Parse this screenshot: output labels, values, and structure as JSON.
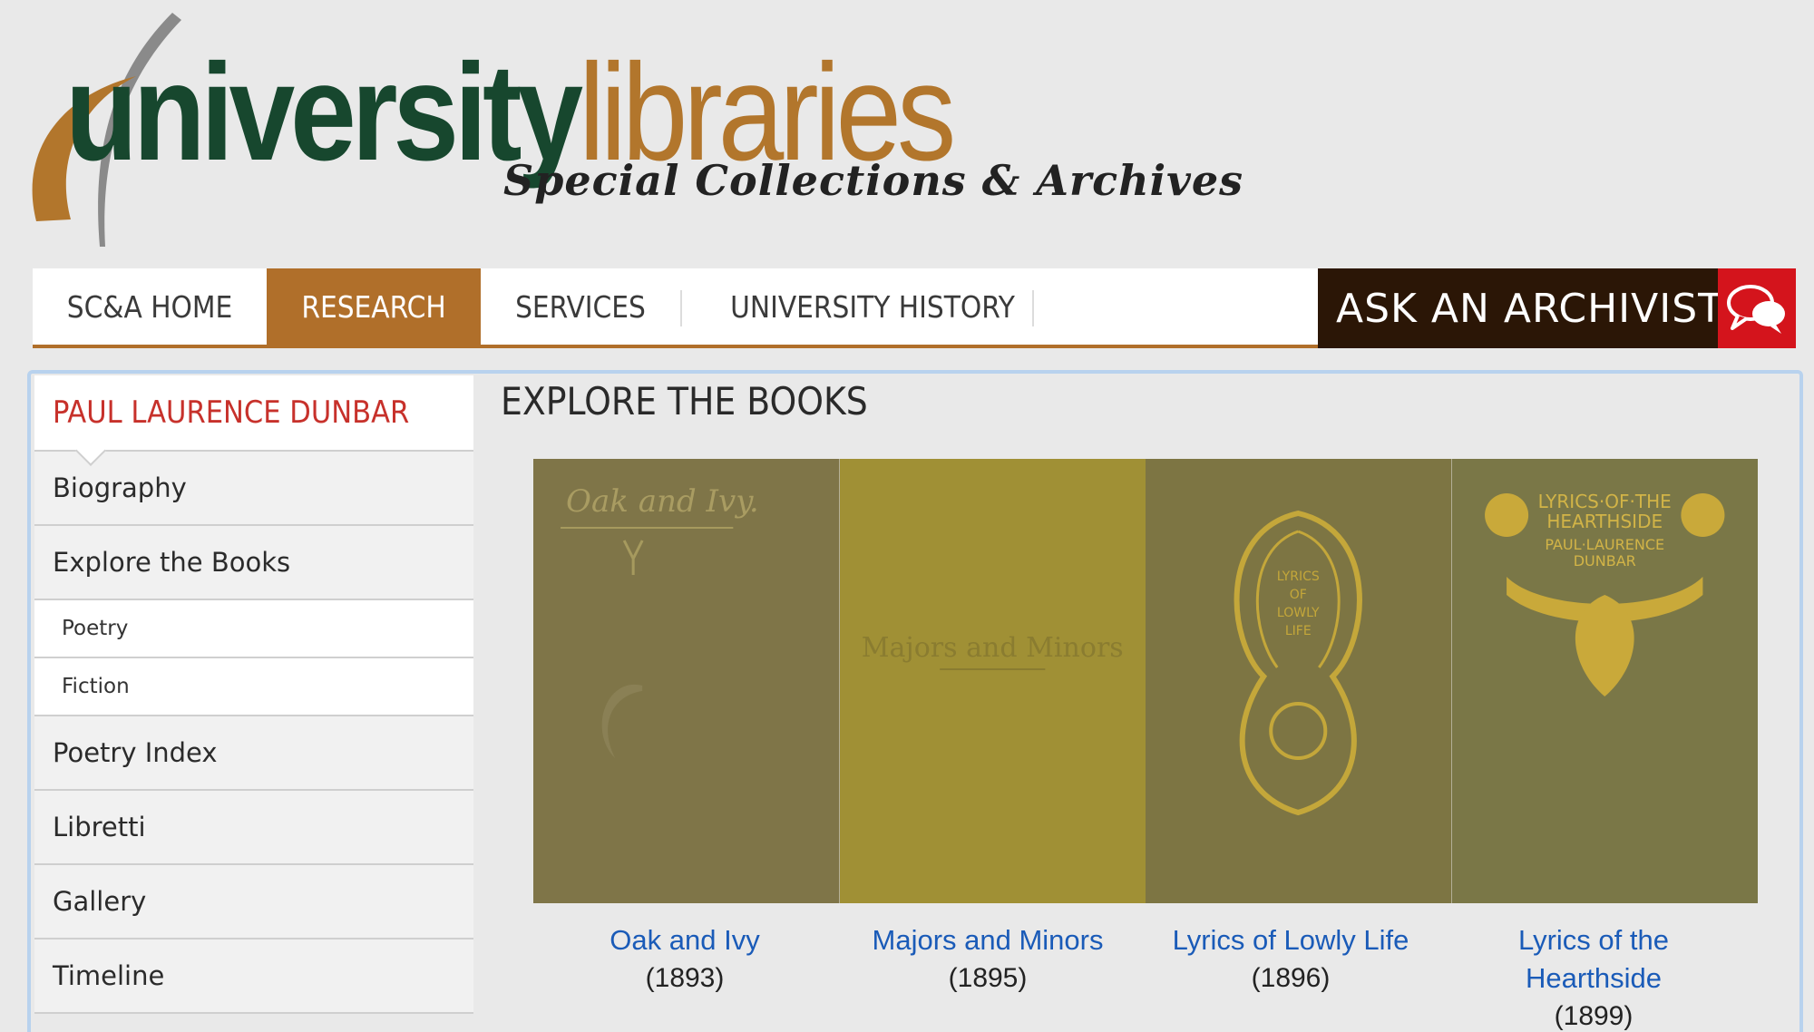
{
  "logo": {
    "word1": "university",
    "word2": "libraries",
    "tagline": "Special Collections & Archives",
    "colors": {
      "green": "#17472e",
      "gold": "#b2762c"
    }
  },
  "nav": {
    "items": [
      {
        "label": "SC&A HOME",
        "active": false
      },
      {
        "label": "RESEARCH",
        "active": true
      },
      {
        "label": "SERVICES",
        "active": false
      },
      {
        "label": "UNIVERSITY HISTORY",
        "active": false
      }
    ],
    "ask_label": "ASK AN ARCHIVIST",
    "ask_icon": "chat-bubbles-icon",
    "accent": "#b06f2a",
    "ask_bg": "#2b1606",
    "ask_icon_bg": "#d4141c"
  },
  "sidebar": {
    "title": "PAUL LAURENCE DUNBAR",
    "items": [
      {
        "label": "Biography"
      },
      {
        "label": "Explore the Books"
      },
      {
        "label": "Poetry"
      },
      {
        "label": "Fiction"
      },
      {
        "label": "Poetry Index"
      },
      {
        "label": "Libretti"
      },
      {
        "label": "Gallery"
      },
      {
        "label": "Timeline"
      }
    ]
  },
  "main": {
    "title": "EXPLORE THE BOOKS",
    "books": [
      {
        "title": "Oak and Ivy",
        "year": "(1893)",
        "cover_text": "Oak and Ivy.",
        "cover_color": "#7f7548"
      },
      {
        "title": "Majors and Minors",
        "year": "(1895)",
        "cover_text": "Majors and Minors",
        "cover_color": "#a09035"
      },
      {
        "title": "Lyrics of Lowly Life",
        "year": "(1896)",
        "cover_text": "LYRICS OF LOWLY LIFE",
        "cover_color": "#7d7543"
      },
      {
        "title": "Lyrics of the Hearthside",
        "year": "(1899)",
        "cover_text": "LYRICS OF THE HEARTHSIDE",
        "cover_color": "#7a7747"
      }
    ],
    "link_color": "#1a5bb8"
  }
}
